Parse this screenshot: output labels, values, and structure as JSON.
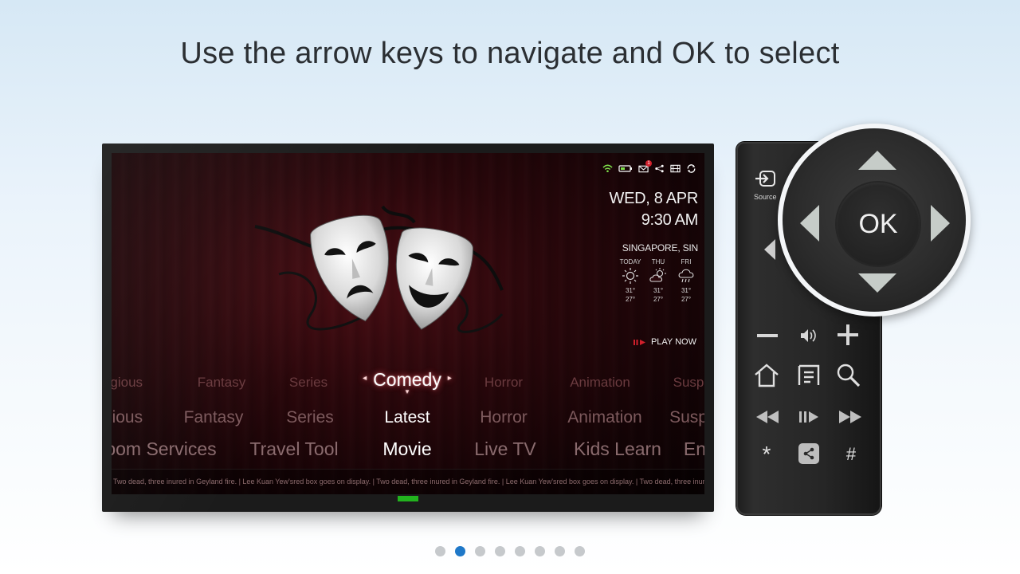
{
  "headline": "Use the arrow keys to navigate and OK to select",
  "tv": {
    "date": "WED, 8 APR",
    "time": "9:30 AM",
    "status_icons": [
      "wifi-icon",
      "battery-icon",
      "mail-icon",
      "share-icon",
      "film-icon",
      "refresh-icon"
    ],
    "mail_badge": "1",
    "weather": {
      "city": "SINGAPORE, SIN",
      "days": [
        {
          "label": "TODAY",
          "icon": "sunny-icon",
          "high": "31°",
          "low": "27°"
        },
        {
          "label": "THU",
          "icon": "partly-cloudy-icon",
          "high": "31°",
          "low": "27°"
        },
        {
          "label": "FRI",
          "icon": "rain-icon",
          "high": "31°",
          "low": "27°"
        }
      ]
    },
    "play_now": "PLAY NOW",
    "genre_row": {
      "items": [
        "Religious",
        "Fantasy",
        "Series",
        "Comedy",
        "Horror",
        "Animation",
        "Suspense"
      ],
      "visible": [
        "egious",
        "Fantasy",
        "Series",
        "Comedy",
        "Horror",
        "Animation",
        "Susp"
      ],
      "selected": "Comedy"
    },
    "sub_row": {
      "visible": [
        "gious",
        "Fantasy",
        "Series",
        "Latest",
        "Horror",
        "Animation",
        "Susp"
      ],
      "selected": "Latest"
    },
    "category_row": {
      "visible": [
        "oom Services",
        "Travel Tool",
        "Movie",
        "Live TV",
        "Kids Learn",
        "En"
      ],
      "selected": "Movie"
    },
    "ticker": "Two dead, three inured in Geyland fire. | Lee Kuan Yew'sred box goes on display. | Two dead, three inured in Geyland fire. | Lee Kuan Yew'sred box goes on display. | Two dead, three inured in Geyland fire. | Lee Kuan Yew'sred box goes on display. | Two dead, three inured in Ge"
  },
  "remote": {
    "source_label": "Source",
    "ok_label": "OK",
    "buttons": [
      "source-icon",
      "volume-down-icon",
      "volume-icon",
      "volume-up-icon",
      "home-icon",
      "menu-icon",
      "search-icon",
      "rewind-icon",
      "play-pause-icon",
      "fast-forward-icon",
      "asterisk-icon",
      "share-icon",
      "hash-icon"
    ],
    "symbols": {
      "asterisk": "*",
      "hash": "#"
    }
  },
  "pagination": {
    "count": 8,
    "active_index": 1
  },
  "colors": {
    "accent": "#1f78c8",
    "power_led": "#22b21e",
    "tv_background": "#2a070b"
  }
}
